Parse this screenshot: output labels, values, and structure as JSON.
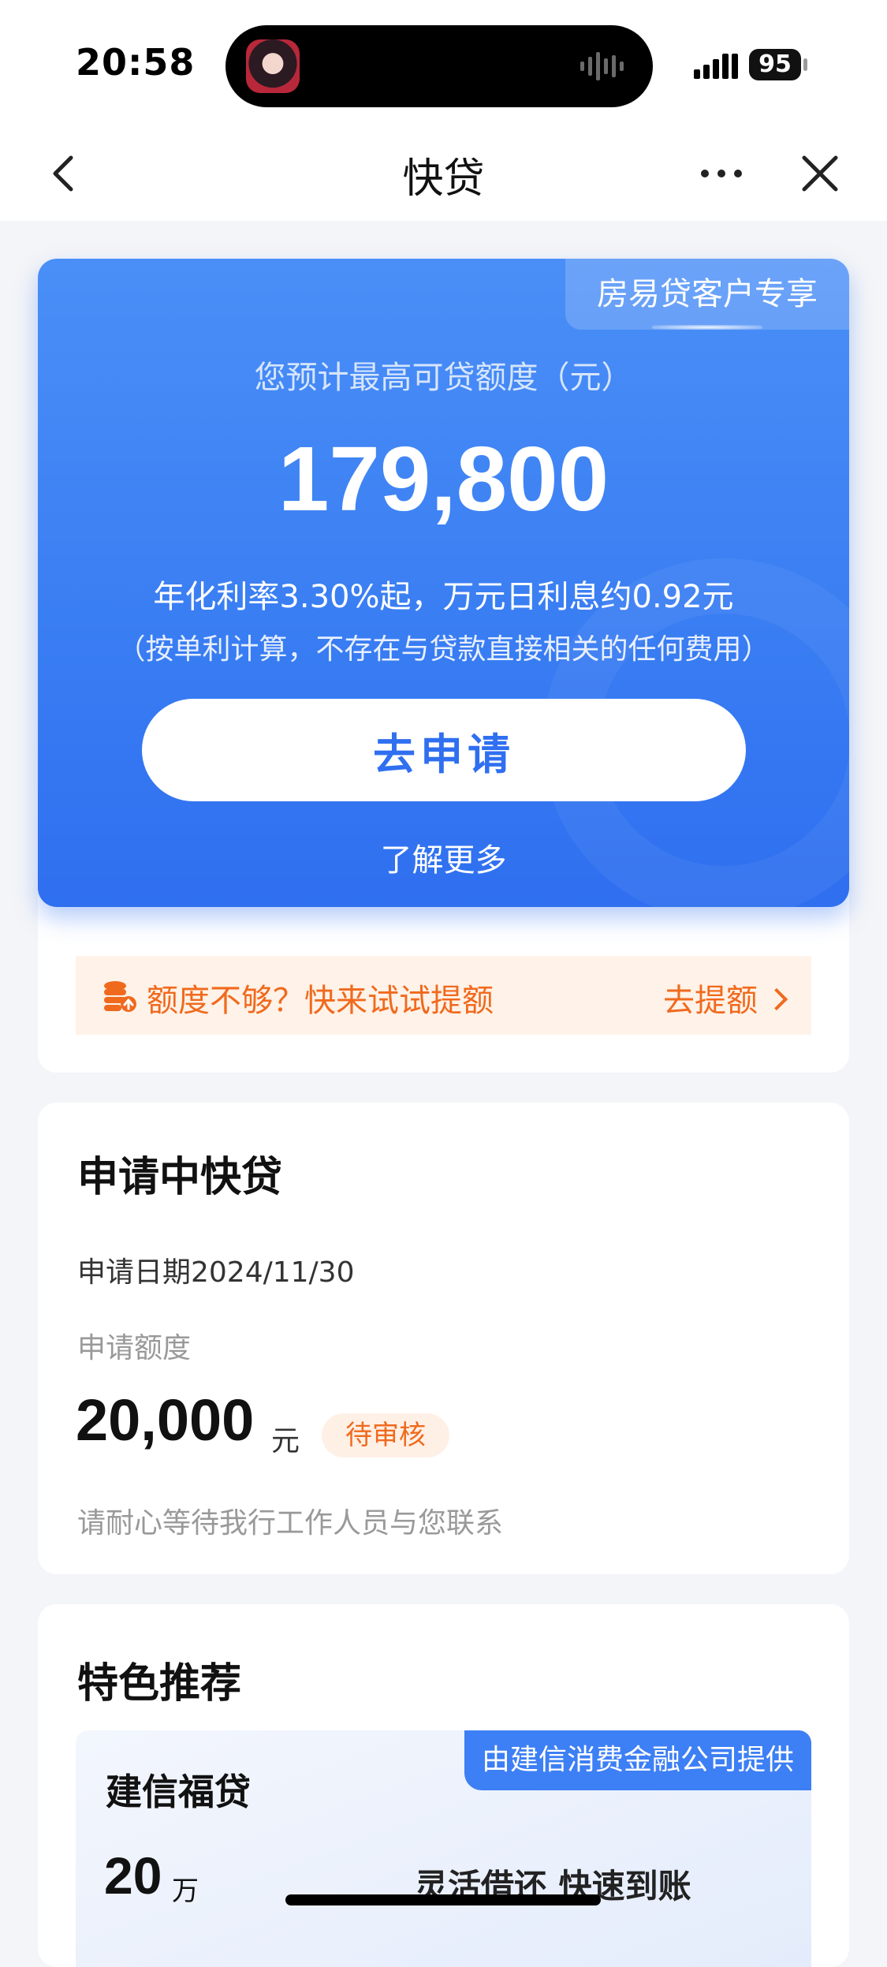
{
  "status_bar": {
    "time": "20:58",
    "battery": "95"
  },
  "nav": {
    "title": "快贷"
  },
  "hero": {
    "badge": "房易贷客户专享",
    "subtitle": "您预计最高可贷额度（元）",
    "amount": "179,800",
    "rate": "年化利率3.30%起，万元日利息约0.92元",
    "note": "（按单利计算，不存在与贷款直接相关的任何费用）",
    "apply_label": "去申请",
    "more_label": "了解更多"
  },
  "boost": {
    "text": "额度不够？快来试试提额",
    "link": "去提额"
  },
  "application": {
    "title": "申请中快贷",
    "date": "申请日期2024/11/30",
    "amount_label": "申请额度",
    "amount": "20,000",
    "unit": "元",
    "status": "待审核",
    "hint": "请耐心等待我行工作人员与您联系"
  },
  "recommend": {
    "title": "特色推荐",
    "item": {
      "badge": "由建信消费金融公司提供",
      "name": "建信福贷",
      "amount": "20",
      "unit": "万",
      "feature": "灵活借还 快速到账"
    }
  },
  "colors": {
    "primary": "#2f6ff0",
    "accent": "#f06a1d",
    "page_bg": "#f4f5f8"
  }
}
